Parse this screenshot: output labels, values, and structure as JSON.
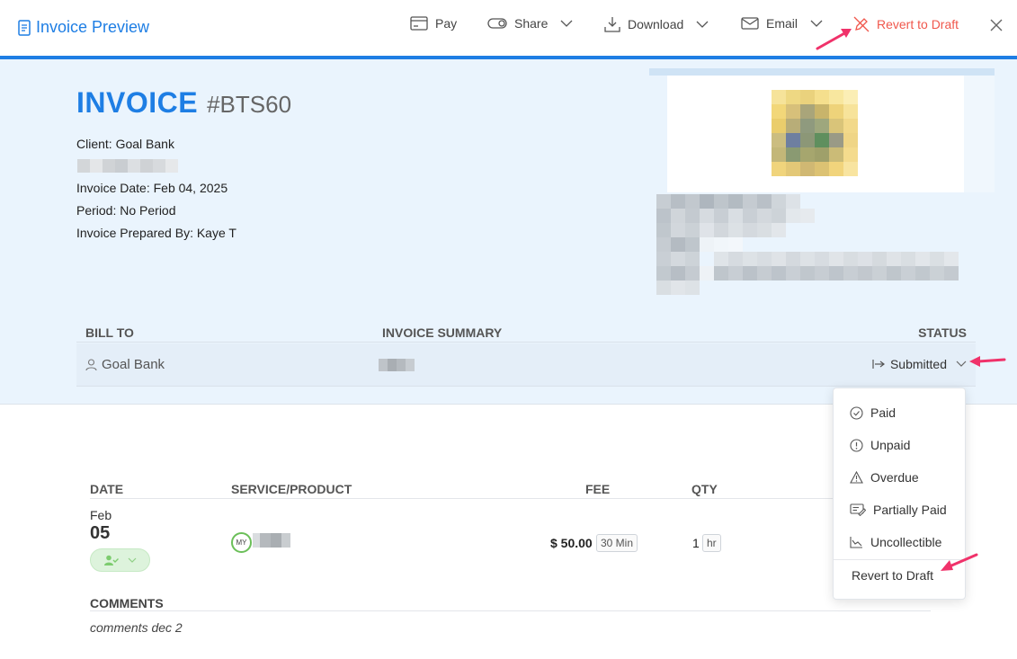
{
  "topbar": {
    "title": "Invoice Preview",
    "pay_label": "Pay",
    "share_label": "Share",
    "download_label": "Download",
    "email_label": "Email",
    "revert_label": "Revert to Draft"
  },
  "invoice": {
    "word": "INVOICE",
    "number": "#BTS60",
    "client": "Client: Goal Bank",
    "invoice_date": "Invoice Date: Feb 04, 2025",
    "period": "Period: No Period",
    "prepared_by": "Invoice Prepared By: Kaye T"
  },
  "summary": {
    "headers": {
      "bill_to": "BILL TO",
      "invoice_summary": "INVOICE SUMMARY",
      "status": "STATUS"
    },
    "client_name": "Goal Bank",
    "status": "Submitted"
  },
  "status_menu": {
    "items": [
      {
        "label": "Paid",
        "icon": "check-circle-icon"
      },
      {
        "label": "Unpaid",
        "icon": "exclamation-circle-icon"
      },
      {
        "label": "Overdue",
        "icon": "warning-triangle-icon"
      },
      {
        "label": "Partially Paid",
        "icon": "partial-payment-icon"
      },
      {
        "label": "Uncollectible",
        "icon": "trend-chart-icon"
      }
    ],
    "revert_label": "Revert to Draft"
  },
  "line_items": {
    "headers": {
      "date": "DATE",
      "service": "SERVICE/PRODUCT",
      "fee": "FEE",
      "qty": "QTY"
    },
    "rows": [
      {
        "month": "Feb",
        "day": "05",
        "avatar_initials": "MY",
        "fee": "$ 50.00",
        "duration": "30 Min",
        "qty": "1",
        "unit": "hr"
      }
    ]
  },
  "comments": {
    "header": "COMMENTS",
    "text": "comments dec 2"
  },
  "colors": {
    "brand_blue": "#1e7ee4",
    "revert_red": "#f0574c",
    "header_bg": "#eaf4fd",
    "annotation_arrow": "#f0326a"
  }
}
